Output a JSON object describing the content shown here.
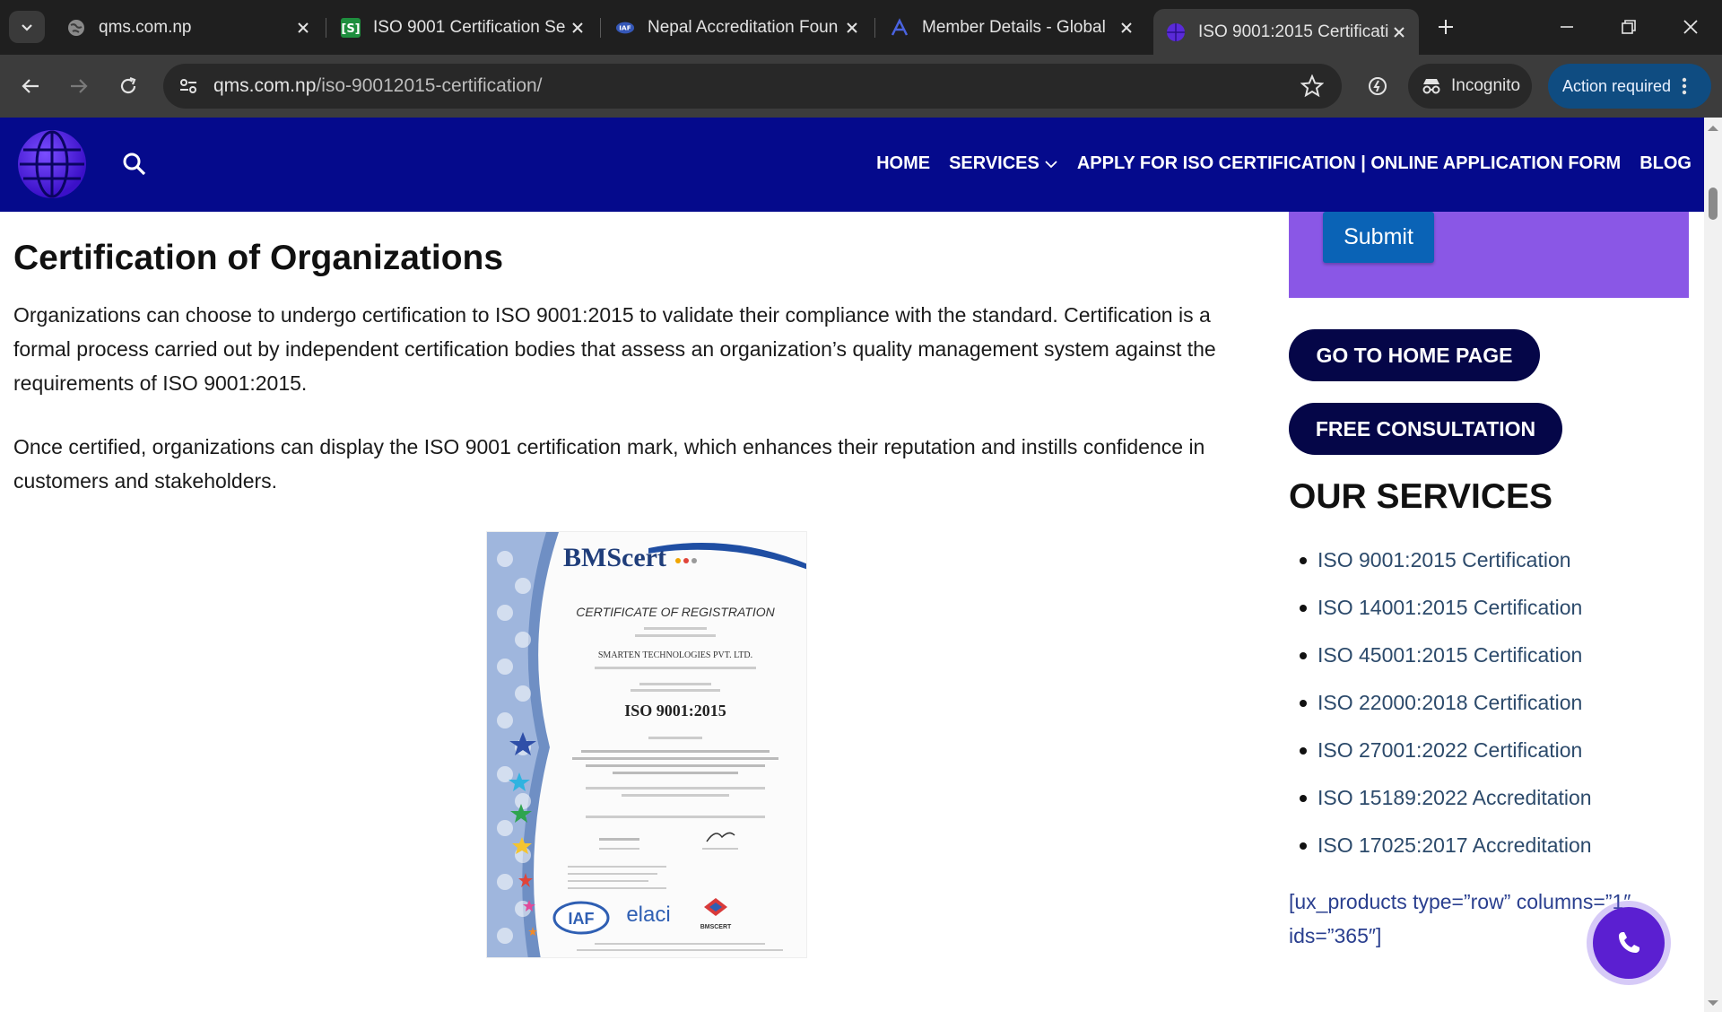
{
  "browser": {
    "tabs": [
      {
        "title": "qms.com.np",
        "icon": "globe-icon"
      },
      {
        "title": "ISO 9001 Certification Se",
        "icon": "s-favicon"
      },
      {
        "title": "Nepal Accreditation Foun",
        "icon": "iaf-favicon"
      },
      {
        "title": "Member Details - Global",
        "icon": "a-favicon"
      },
      {
        "title": "ISO 9001:2015 Certificatio",
        "icon": "site-favicon",
        "active": true
      }
    ],
    "url_domain": "qms.com.np",
    "url_path": "/iso-90012015-certification/",
    "incognito_label": "Incognito",
    "action_label": "Action required"
  },
  "site": {
    "nav": {
      "home": "HOME",
      "services": "SERVICES",
      "apply": "APPLY FOR ISO CERTIFICATION | ONLINE APPLICATION FORM",
      "blog": "BLOG"
    }
  },
  "main": {
    "heading": "Certification of Organizations",
    "para1": "Organizations can choose to undergo certification to ISO 9001:2015 to validate their compliance with the standard. Certification is a formal process carried out by independent certification bodies that assess an organization’s quality management system against the requirements of ISO 9001:2015.",
    "para2": "Once certified, organizations can display the ISO 9001 certification mark, which enhances their reputation and instills confidence in customers and stakeholders.",
    "certificate": {
      "brand": "BMScert",
      "title": "CERTIFICATE OF REGISTRATION",
      "company": "SMARTEN TECHNOLOGIES PVT. LTD.",
      "standard": "ISO 9001:2015",
      "logos": [
        "IAF",
        "elaci",
        "BMSCERT"
      ]
    }
  },
  "sidebar": {
    "submit_label": "Submit",
    "home_button": "GO TO HOME PAGE",
    "consult_button": "FREE CONSULTATION",
    "services_title": "OUR SERVICES",
    "services": [
      "ISO 9001:2015 Certification",
      "ISO 14001:2015 Certification",
      "ISO 45001:2015 Certification",
      "ISO 22000:2018 Certification",
      "ISO 27001:2022 Certification",
      "ISO 15189:2022 Accreditation",
      "ISO 17025:2017 Accreditation"
    ],
    "shortcode": "[ux_products type=”row” columns=”1″ ids=”365″]"
  },
  "colors": {
    "header_bg": "#050a8c",
    "form_bg": "#8a57e6",
    "pill_bg": "#050648",
    "submit_bg": "#0a63b6",
    "call_btn": "#5b1fd1"
  }
}
